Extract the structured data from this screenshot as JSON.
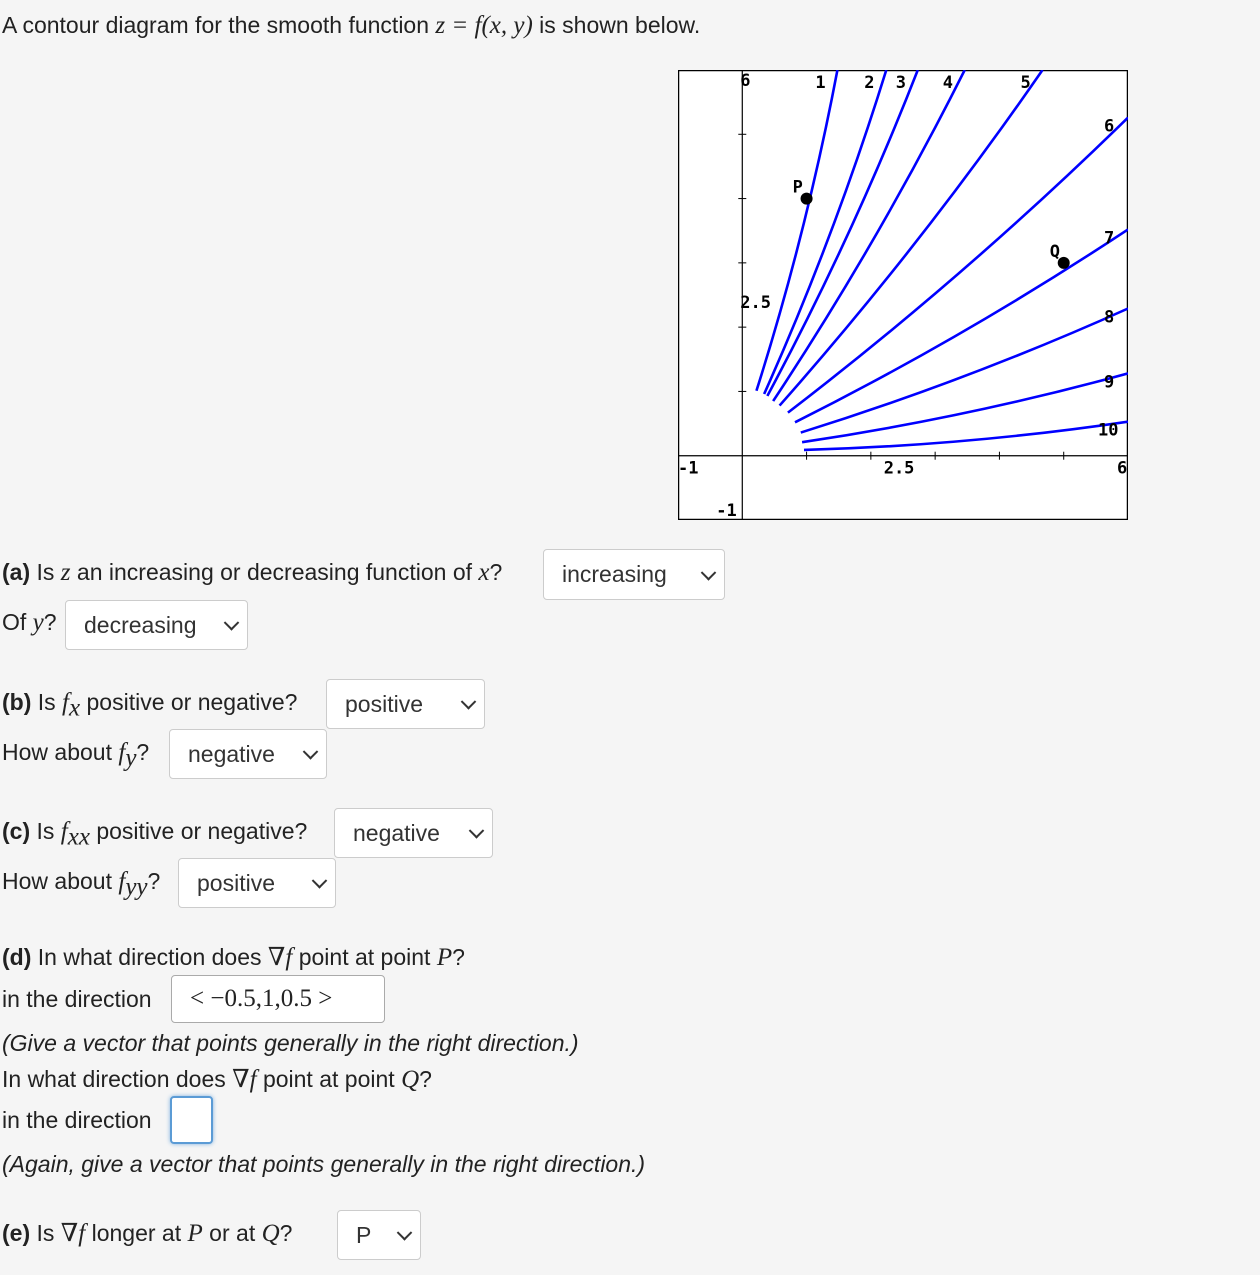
{
  "intro": {
    "text_before": "A contour diagram for the smooth function ",
    "math": "z = f(x, y)",
    "text_after": " is shown below."
  },
  "part_a": {
    "label": "(a)",
    "q1_pre": " Is ",
    "q1_var": "z",
    "q1_mid": " an increasing or decreasing function of ",
    "q1_var2": "x",
    "q1_end": "?",
    "q1_answer": "increasing",
    "q2_pre": "Of ",
    "q2_var": "y",
    "q2_end": "?",
    "q2_answer": "decreasing"
  },
  "part_b": {
    "label": "(b)",
    "q1_pre": " Is ",
    "q1_f": "f",
    "q1_sub": "x",
    "q1_end": " positive or negative?",
    "q1_answer": "positive",
    "q2_pre": "How about ",
    "q2_f": "f",
    "q2_sub": "y",
    "q2_end": "?",
    "q2_answer": "negative"
  },
  "part_c": {
    "label": "(c)",
    "q1_pre": " Is ",
    "q1_f": "f",
    "q1_sub": "xx",
    "q1_end": " positive or negative?",
    "q1_answer": "negative",
    "q2_pre": "How about ",
    "q2_f": "f",
    "q2_sub": "yy",
    "q2_end": "?",
    "q2_answer": "positive"
  },
  "part_d": {
    "label": "(d)",
    "q1_pre": " In what direction does ",
    "nabla": "∇",
    "f": "f",
    "q1_mid": " point at point ",
    "q1_pt": "P",
    "q1_end": "?",
    "dir_label": "in the direction",
    "p_answer": "< −0.5,1,0.5 >",
    "note1": "(Give a vector that points generally in the right direction.)",
    "q2_pre": "In what direction does ",
    "q2_mid": " point at point ",
    "q2_pt": "Q",
    "q2_end": "?",
    "q_answer": "",
    "note2": "(Again, give a vector that points generally in the right direction.)"
  },
  "part_e": {
    "label": "(e)",
    "pre": " Is ",
    "nabla": "∇",
    "f": "f",
    "mid": " longer at ",
    "p": "P",
    "or": " or at ",
    "q": "Q",
    "end": "?",
    "answer": "P"
  },
  "chart_data": {
    "type": "contour",
    "xlim": [
      -1,
      6
    ],
    "ylim": [
      -1,
      6
    ],
    "axis_labels": {
      "x_min": "-1",
      "x_mid": "2.5",
      "x_max": "6",
      "y_min": "-1",
      "y_mid": "2.5",
      "y_max": "6"
    },
    "ticks": [
      1,
      2,
      3,
      4,
      5
    ],
    "line_color": "#0000ff",
    "contours": [
      {
        "level": "1",
        "start": [
          0.22,
          1.01
        ],
        "end": [
          1.48,
          6.0
        ]
      },
      {
        "level": "2",
        "start": [
          0.34,
          0.96
        ],
        "end": [
          2.24,
          6.0
        ]
      },
      {
        "level": "3",
        "start": [
          0.39,
          0.93
        ],
        "end": [
          2.73,
          6.0
        ]
      },
      {
        "level": "4",
        "start": [
          0.48,
          0.85
        ],
        "end": [
          3.46,
          6.0
        ]
      },
      {
        "level": "5",
        "start": [
          0.58,
          0.78
        ],
        "end": [
          4.67,
          6.0
        ]
      },
      {
        "level": "6",
        "start": [
          0.71,
          0.67
        ],
        "end": [
          6.0,
          5.26
        ]
      },
      {
        "level": "7",
        "start": [
          0.82,
          0.52
        ],
        "end": [
          6.0,
          3.52
        ]
      },
      {
        "level": "8",
        "start": [
          0.91,
          0.36
        ],
        "end": [
          6.0,
          2.29
        ]
      },
      {
        "level": "9",
        "start": [
          0.93,
          0.21
        ],
        "end": [
          6.0,
          1.28
        ]
      },
      {
        "level": "10",
        "start": [
          0.96,
          0.09
        ],
        "end": [
          6.0,
          0.53
        ]
      }
    ],
    "points": [
      {
        "label": "P",
        "x": 1,
        "y": 4
      },
      {
        "label": "Q",
        "x": 5,
        "y": 3
      }
    ]
  }
}
